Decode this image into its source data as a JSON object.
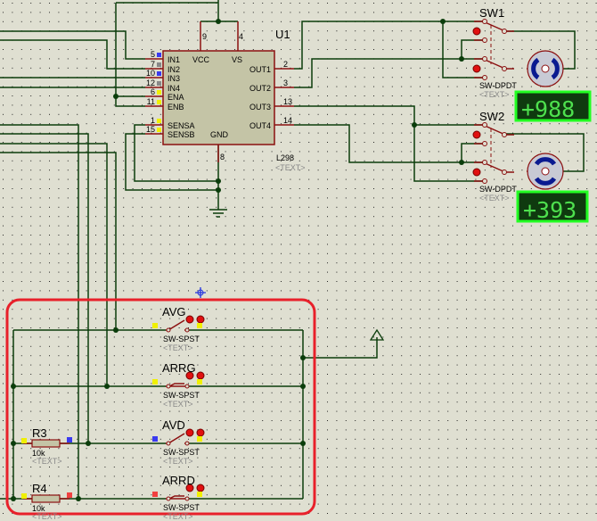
{
  "chip": {
    "ref": "U1",
    "part": "L298",
    "text": "<TEXT>",
    "left_pins": [
      {
        "num": "5",
        "name": "IN1"
      },
      {
        "num": "7",
        "name": "IN2"
      },
      {
        "num": "10",
        "name": "IN3"
      },
      {
        "num": "12",
        "name": "IN4"
      },
      {
        "num": "6",
        "name": "ENA"
      },
      {
        "num": "11",
        "name": "ENB"
      },
      {
        "num": "1",
        "name": "SENSA"
      },
      {
        "num": "15",
        "name": "SENSB"
      }
    ],
    "right_pins": [
      {
        "num": "2",
        "name": "OUT1"
      },
      {
        "num": "3",
        "name": "OUT2"
      },
      {
        "num": "13",
        "name": "OUT3"
      },
      {
        "num": "14",
        "name": "OUT4"
      }
    ],
    "top_pins": [
      {
        "num": "9",
        "name": "VCC"
      },
      {
        "num": "4",
        "name": "VS"
      }
    ],
    "bottom_pin": {
      "num": "8",
      "name": "GND"
    }
  },
  "switches_dpdt": [
    {
      "ref": "SW1",
      "part": "SW-DPDT",
      "text": "<TEXT>"
    },
    {
      "ref": "SW2",
      "part": "SW-DPDT",
      "text": "<TEXT>"
    }
  ],
  "counters": [
    {
      "value": "+988"
    },
    {
      "value": "+393"
    }
  ],
  "switches_spst": [
    {
      "ref": "AVG",
      "part": "SW-SPST",
      "text": "<TEXT>",
      "closed": false
    },
    {
      "ref": "ARRG",
      "part": "SW-SPST",
      "text": "<TEXT>",
      "closed": true
    },
    {
      "ref": "AVD",
      "part": "SW-SPST",
      "text": "<TEXT>",
      "closed": false
    },
    {
      "ref": "ARRD",
      "part": "SW-SPST",
      "text": "<TEXT>",
      "closed": true
    }
  ],
  "resistors": [
    {
      "ref": "R3",
      "value": "10k",
      "text": "<TEXT>"
    },
    {
      "ref": "R4",
      "value": "10k",
      "text": "<TEXT>"
    }
  ],
  "colors": {
    "wire": "#0b3d0b",
    "pin": "#8b1010",
    "selection": "#e8202a",
    "counter_text": "#4ee04e",
    "counter_border": "#22ff22"
  }
}
